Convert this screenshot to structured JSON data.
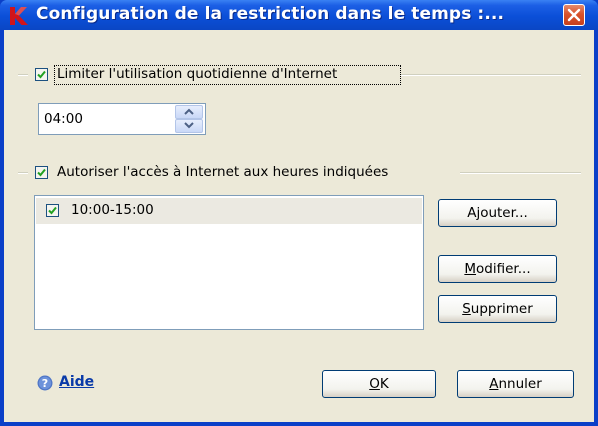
{
  "window": {
    "title": "Configuration de la restriction dans le temps :..."
  },
  "limit_section": {
    "checked": true,
    "label": "Limiter l'utilisation quotidienne d'Internet",
    "time_value": "04:00"
  },
  "allow_section": {
    "checked": true,
    "label": "Autoriser l'accès à Internet aux heures indiquées",
    "intervals": [
      {
        "checked": true,
        "label": "10:00-15:00"
      }
    ]
  },
  "buttons": {
    "add_prefix": "A",
    "add_mnemonic": "j",
    "add_rest": "outer...",
    "edit_prefix": "",
    "edit_mnemonic": "M",
    "edit_rest": "odifier...",
    "delete_prefix": "",
    "delete_mnemonic": "S",
    "delete_rest": "upprimer",
    "ok_prefix": "",
    "ok_mnemonic": "O",
    "ok_rest": "K",
    "cancel_prefix": "",
    "cancel_mnemonic": "A",
    "cancel_rest": "nnuler"
  },
  "help": {
    "label": "Aide"
  },
  "colors": {
    "title_bar": "#0b4fd8",
    "dialog_bg": "#ece9d8",
    "close_button": "#d9532c",
    "logo_red": "#d0141b",
    "link": "#0a3aa8"
  }
}
